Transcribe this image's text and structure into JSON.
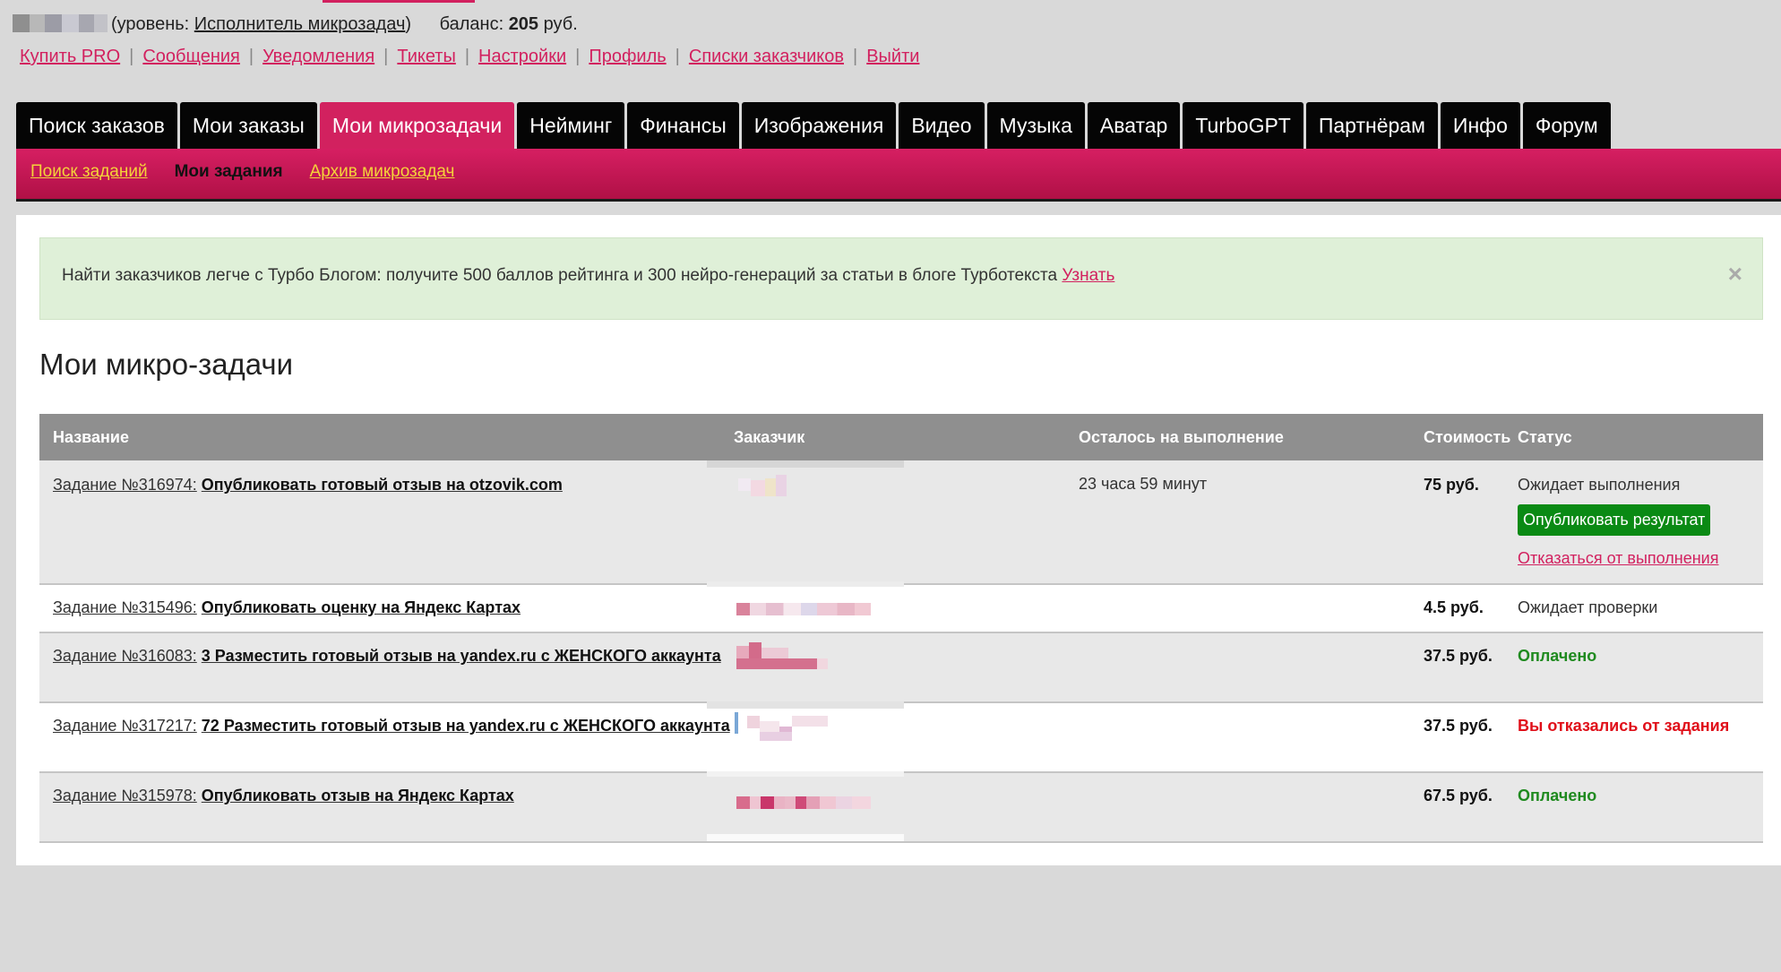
{
  "header": {
    "level_prefix": "(уровень: ",
    "level": "Исполнитель микрозадач",
    "level_suffix": ")",
    "balance_label": "баланс: ",
    "balance_value": "205",
    "balance_unit": " руб."
  },
  "topnav": [
    "Купить PRO",
    "Сообщения",
    "Уведомления",
    "Тикеты",
    "Настройки",
    "Профиль",
    "Списки заказчиков",
    "Выйти"
  ],
  "tabs": [
    "Поиск заказов",
    "Мои заказы",
    "Мои микрозадачи",
    "Нейминг",
    "Финансы",
    "Изображения",
    "Видео",
    "Музыка",
    "Аватар",
    "TurboGPT",
    "Партнёрам",
    "Инфо",
    "Форум"
  ],
  "active_tab": "Мои микрозадачи",
  "subnav": {
    "search": "Поиск заданий",
    "current": "Мои задания",
    "archive": "Архив микрозадач"
  },
  "alert": {
    "text": "Найти заказчиков легче с Турбо Блогом: получите 500 баллов рейтинга и 300 нейро-генераций за статьи в блоге Турботекста ",
    "link": "Узнать",
    "close": "×"
  },
  "page_title": "Мои микро-задачи",
  "table": {
    "headers": [
      "Название",
      "Заказчик",
      "Осталось на выполнение",
      "Стоимость",
      "Статус"
    ],
    "rows": [
      {
        "id": "Задание №316974:",
        "title": "Опубликовать готовый отзыв на otzovik.com",
        "left": "23 часа 59 минут",
        "cost": "75 руб.",
        "status": "Ожидает выполнения",
        "status_type": "plain",
        "action": "Опубликовать результат",
        "refuse": "Отказаться от выполнения"
      },
      {
        "id": "Задание №315496:",
        "title": "Опубликовать оценку на Яндекс Картах",
        "left": "",
        "cost": "4.5 руб.",
        "status": "Ожидает проверки",
        "status_type": "plain"
      },
      {
        "id": "Задание №316083:",
        "title": "3 Разместить готовый отзыв на yandex.ru с ЖЕНСКОГО аккаунта",
        "left": "",
        "cost": "37.5 руб.",
        "status": "Оплачено",
        "status_type": "green"
      },
      {
        "id": "Задание №317217:",
        "title": "72 Разместить готовый отзыв на yandex.ru с ЖЕНСКОГО аккаунта",
        "left": "",
        "cost": "37.5 руб.",
        "status": "Вы отказались от задания",
        "status_type": "red"
      },
      {
        "id": "Задание №315978:",
        "title": "Опубликовать отзыв на Яндекс Картах",
        "left": "",
        "cost": "67.5 руб.",
        "status": "Оплачено",
        "status_type": "green"
      }
    ]
  },
  "colors": {
    "brand": "#d2215f",
    "success": "#0a8a14",
    "danger": "#e0101a",
    "alert_bg": "#dff0d8"
  }
}
